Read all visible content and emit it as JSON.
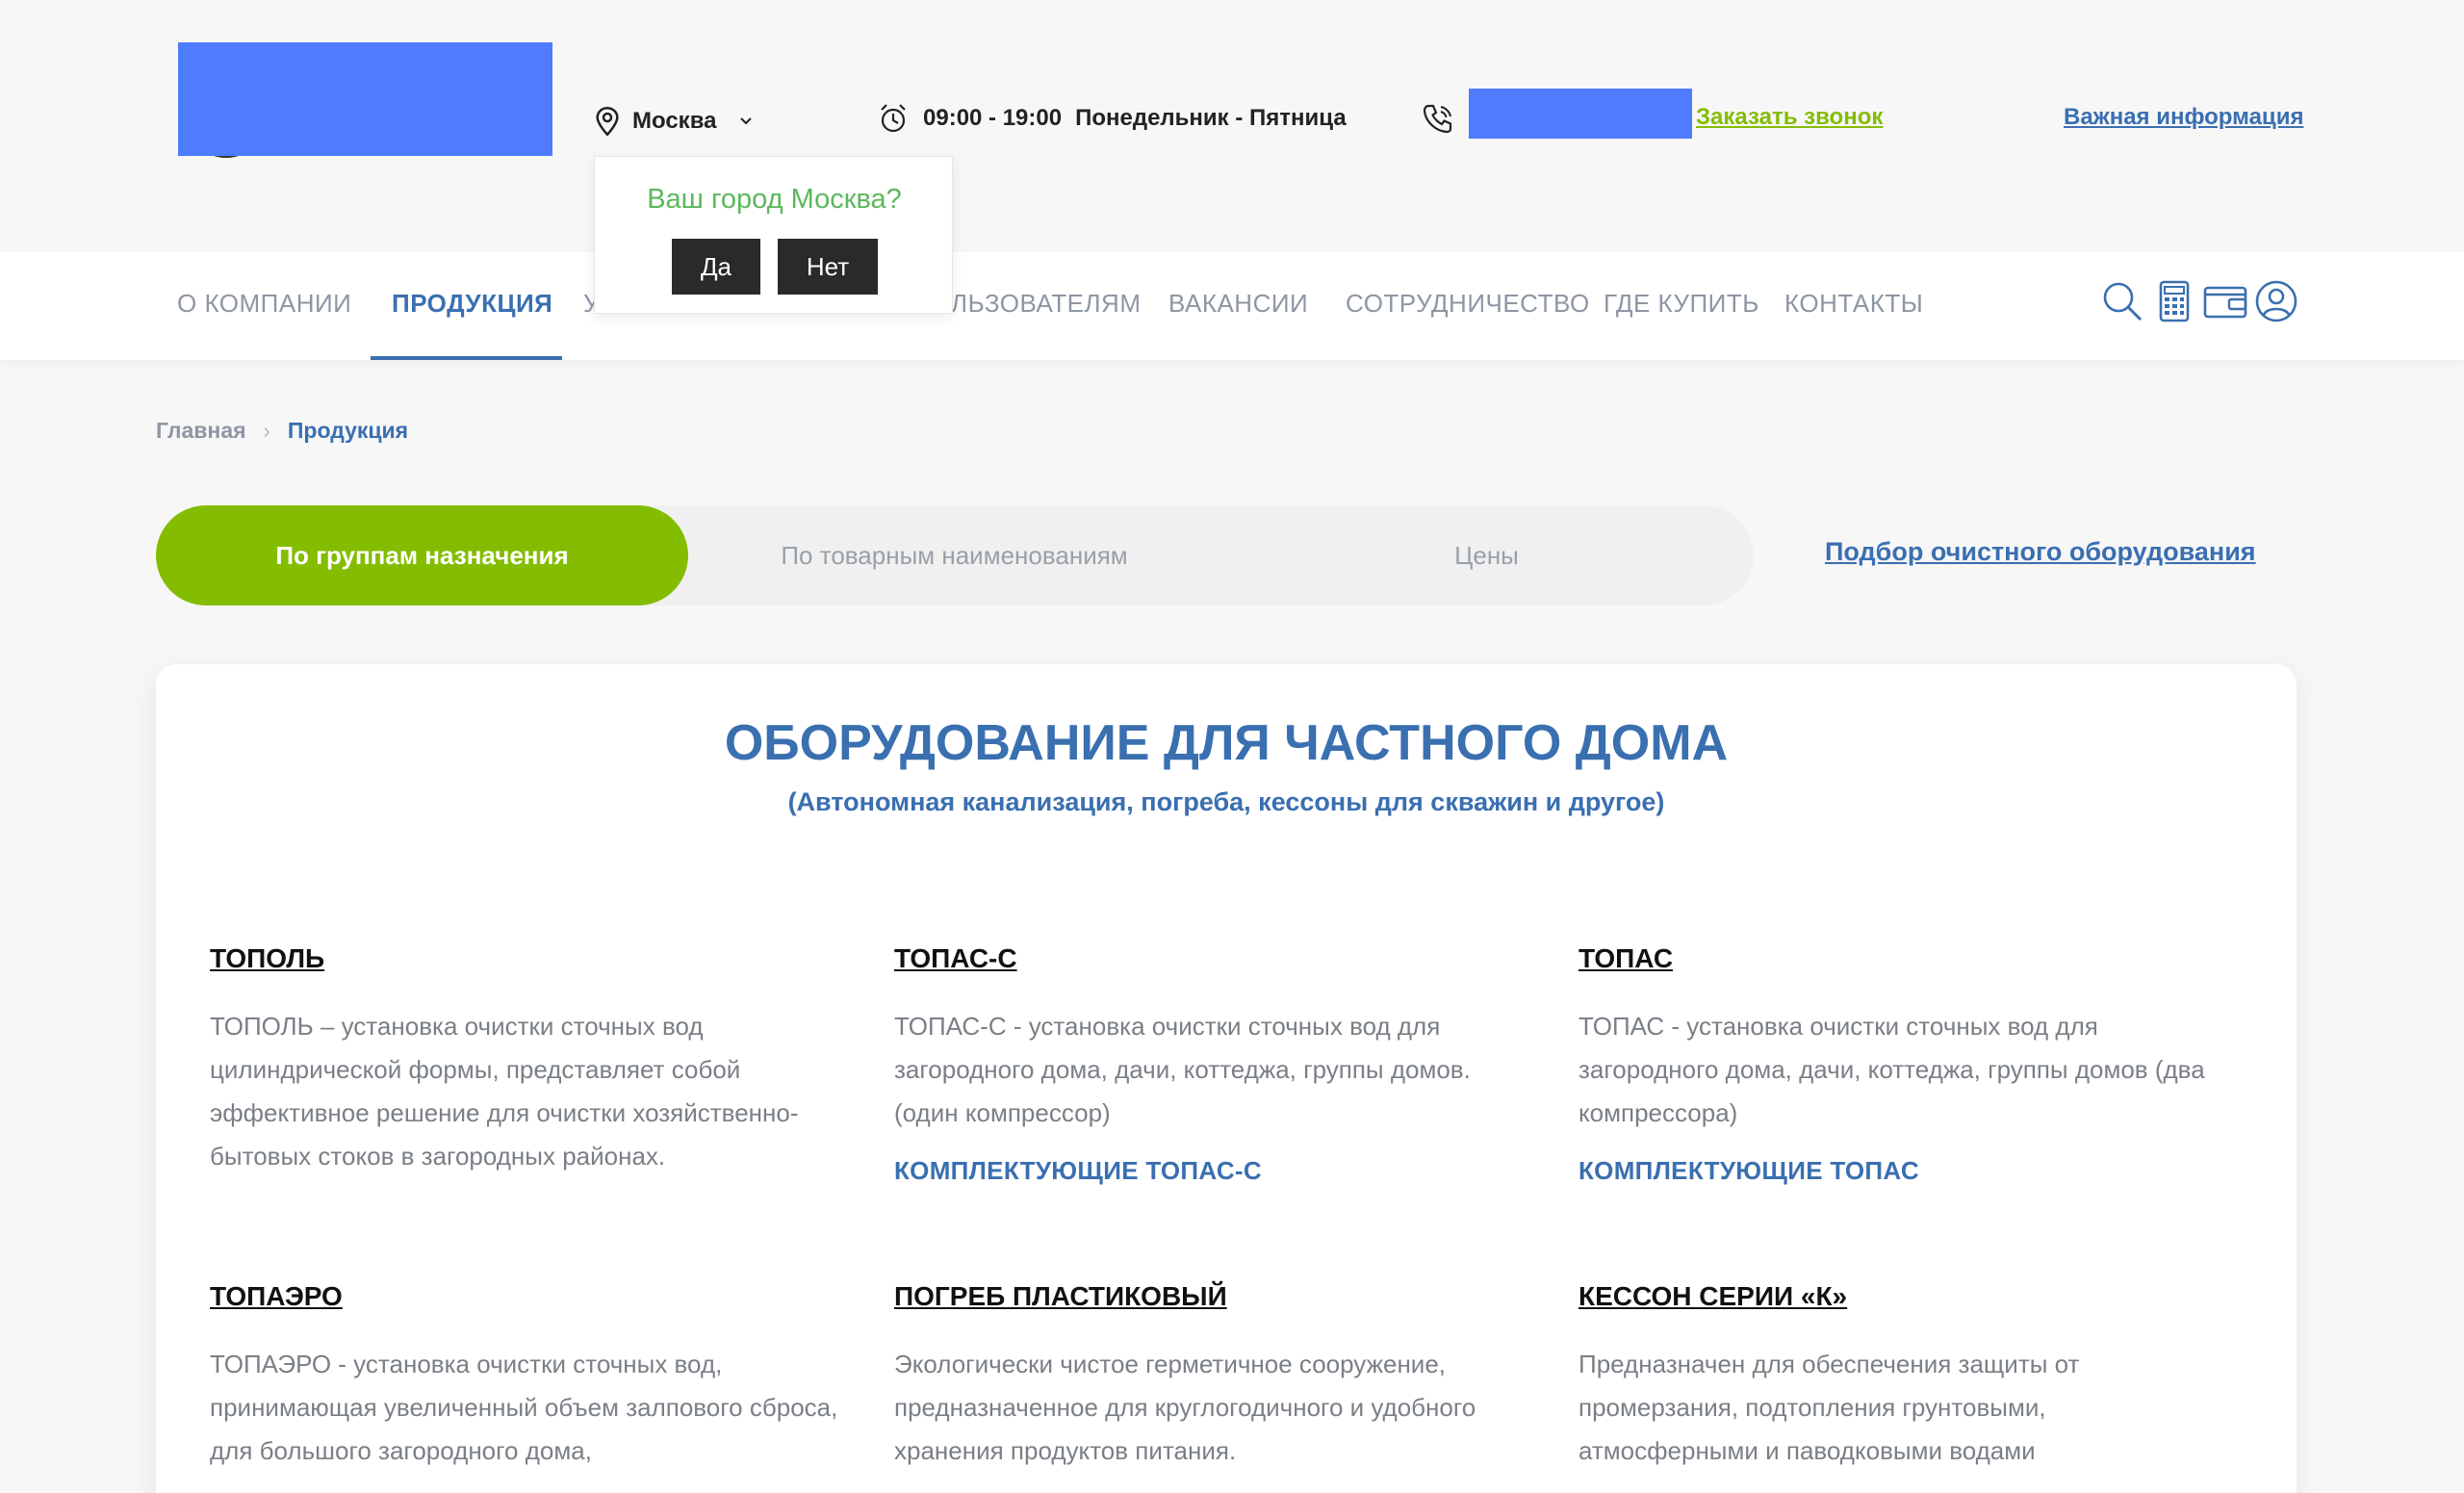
{
  "header": {
    "city": "Москва",
    "hours": "09:00 - 19:00",
    "days": "Понедельник - Пятница",
    "callback_label": "Заказать звонок",
    "important_label": "Важная информация"
  },
  "city_popup": {
    "question": "Ваш город Москва?",
    "yes_label": "Да",
    "no_label": "Нет"
  },
  "nav": {
    "items": [
      {
        "label": "О КОМПАНИИ"
      },
      {
        "label": "ПРОДУКЦИЯ"
      },
      {
        "label": "У"
      },
      {
        "label": "ЛЬЗОВАТЕЛЯМ"
      },
      {
        "label": "ВАКАНСИИ"
      },
      {
        "label": "СОТРУДНИЧЕСТВО"
      },
      {
        "label": "ГДЕ КУПИТЬ"
      },
      {
        "label": "КОНТАКТЫ"
      }
    ],
    "active_index": 1,
    "icons": [
      "search-icon",
      "calculator-icon",
      "wallet-icon",
      "user-icon"
    ]
  },
  "breadcrumb": {
    "home": "Главная",
    "current": "Продукция"
  },
  "tabs": [
    {
      "label": "По группам назначения",
      "active": true
    },
    {
      "label": "По товарным наименованиям",
      "active": false
    },
    {
      "label": "Цены",
      "active": false
    }
  ],
  "selection_link": "Подбор очистного оборудования",
  "section": {
    "title": "ОБОРУДОВАНИЕ ДЛЯ ЧАСТНОГО ДОМА",
    "subtitle": "(Автономная канализация, погреба, кессоны для скважин и другое)"
  },
  "products": [
    {
      "title": "ТОПОЛЬ",
      "desc": "ТОПОЛЬ – установка очистки сточных вод цилиндрической формы, представляет собой эффективное решение для очистки хозяйственно-бытовых стоков в загородных районах."
    },
    {
      "title": "ТОПАС-С",
      "desc": "ТОПАС-С - установка очистки сточных вод для загородного дома, дачи, коттеджа, группы домов. (один компрессор)",
      "link": "КОМПЛЕКТУЮЩИЕ ТОПАС-С"
    },
    {
      "title": "ТОПАС",
      "desc": "ТОПАС - установка очистки сточных вод для загородного дома, дачи, коттеджа, группы домов (два компрессора)",
      "link": "КОМПЛЕКТУЮЩИЕ ТОПАС"
    },
    {
      "title": "ТОПАЭРО",
      "desc": "ТОПАЭРО - установка очистки сточных вод, принимающая увеличенный объем залпового сброса, для большого загородного дома,"
    },
    {
      "title": "ПОГРЕБ ПЛАСТИКОВЫЙ",
      "desc": "Экологически чистое герметичное сооружение, предназначенное для круглогодичного и удобного хранения продуктов питания."
    },
    {
      "title": "КЕССОН СЕРИИ «К»",
      "desc": "Предназначен для обеспечения защиты от промерзания, подтопления грунтовыми, атмосферными и паводковыми водами"
    }
  ],
  "colors": {
    "accent_green": "#84bd00",
    "brand_blue": "#3a6fb0",
    "popup_green": "#5cb85c"
  }
}
